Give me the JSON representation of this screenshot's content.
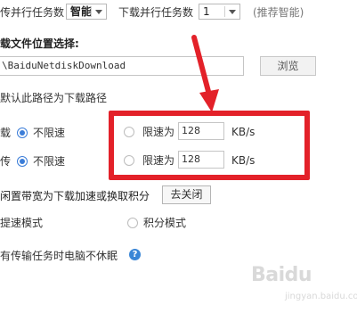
{
  "top_row": {
    "concurrent_tasks_label": "传并行任务数",
    "concurrent_tasks_value": "智能",
    "download_tasks_label": "下载并行任务数",
    "download_tasks_value": "1",
    "recommend_note": "(推荐智能)"
  },
  "download_location": {
    "section_label": "载文件位置选择:",
    "path_value": "\\BaiduNetdiskDownload",
    "browse_button": "浏览",
    "default_path_checkbox_label": "默认此路径为下载路径"
  },
  "speed_limits": {
    "download": {
      "row_prefix": "载",
      "unlimited_label": "不限速",
      "limit_label": "限速为",
      "limit_value": "128",
      "unit": "KB/s"
    },
    "upload": {
      "row_prefix": "传",
      "unlimited_label": "不限速",
      "limit_label": "限速为",
      "limit_value": "128",
      "unit": "KB/s"
    }
  },
  "idle_bandwidth": {
    "label": "闲置带宽为下载加速或换取积分",
    "close_button": "去关闭",
    "accel_mode_label": "提速模式",
    "points_mode_label": "积分模式"
  },
  "no_sleep": {
    "label": "有传输任务时电脑不休眠",
    "help_icon_text": "?"
  },
  "annotation": {
    "highlight_color": "#e32129"
  },
  "watermark": {
    "brand": "Baidu",
    "sub": "jingyan.baidu.com"
  }
}
